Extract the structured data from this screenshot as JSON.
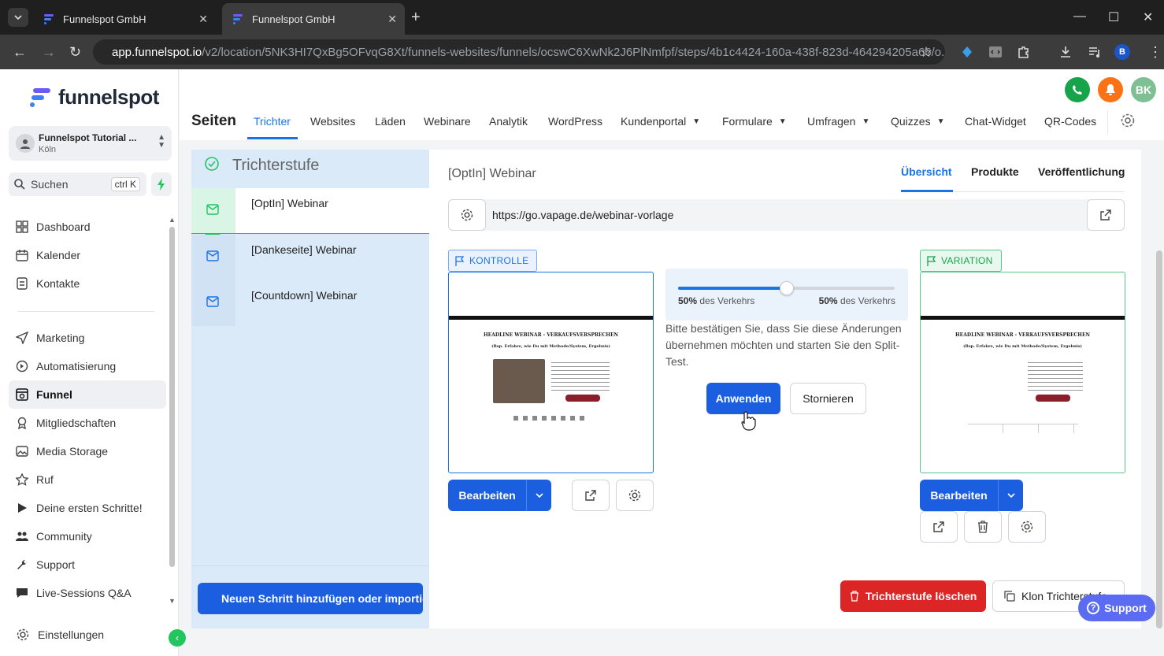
{
  "browser": {
    "tabs": [
      {
        "title": "Funnelspot GmbH",
        "active": false
      },
      {
        "title": "Funnelspot GmbH",
        "active": true
      }
    ],
    "address_host": "app.funnelspot.io",
    "address_path": "/v2/location/5NK3HI7QxBg5OFvqG8Xt/funnels-websites/funnels/ocswC6XwNk2J6PlNmfpf/steps/4b1c4424-160a-438f-823d-464294205a66/o...",
    "profile_initial": "B"
  },
  "sidebar": {
    "brand": "funnelspot",
    "location_name": "Funnelspot Tutorial ...",
    "location_city": "Köln",
    "search_label": "Suchen",
    "search_shortcut": "ctrl K",
    "items": [
      {
        "label": "Dashboard",
        "icon": "grid-icon"
      },
      {
        "label": "Kalender",
        "icon": "calendar-icon"
      },
      {
        "label": "Kontakte",
        "icon": "contacts-icon"
      },
      {
        "label": "Marketing",
        "icon": "send-icon"
      },
      {
        "label": "Automatisierung",
        "icon": "automation-icon"
      },
      {
        "label": "Funnel",
        "icon": "funnel-icon",
        "active": true
      },
      {
        "label": "Mitgliedschaften",
        "icon": "badge-icon"
      },
      {
        "label": "Media Storage",
        "icon": "image-icon"
      },
      {
        "label": "Ruf",
        "icon": "star-icon"
      },
      {
        "label": "Deine ersten Schritte!",
        "icon": "play-icon"
      },
      {
        "label": "Community",
        "icon": "users-icon"
      },
      {
        "label": "Support",
        "icon": "wrench-icon"
      },
      {
        "label": "Live-Sessions Q&A",
        "icon": "chat-icon"
      }
    ],
    "settings_label": "Einstellungen"
  },
  "topbar": {
    "avatar_initials": "BK",
    "page_title": "Seiten",
    "tabs": [
      "Trichter",
      "Websites",
      "Läden",
      "Webinare",
      "Analytik",
      "WordPress",
      "Kundenportal",
      "Formulare",
      "Umfragen",
      "Quizzes",
      "Chat-Widget",
      "QR-Codes"
    ]
  },
  "funnel": {
    "section_title": "Trichterstufe",
    "steps": [
      "[OptIn] Webinar",
      "[Dankeseite] Webinar",
      "[Countdown] Webinar"
    ],
    "add_step_label": "Neuen Schritt hinzufügen oder importieren"
  },
  "step_detail": {
    "title": "[OptIn] Webinar",
    "tabs": [
      "Übersicht",
      "Produkte",
      "Veröffentlichung"
    ],
    "url": "https://go.vapage.de/webinar-vorlage",
    "control_badge": "KONTROLLE",
    "variation_badge": "VARIATION",
    "split_left_pct": "50%",
    "split_right_pct": "50%",
    "split_suffix": "des Verkehrs",
    "traffic_split_fraction": 0.5,
    "confirm_text": "Bitte bestätigen Sie, dass Sie diese Änderungen übernehmen möchten und starten Sie den Split-Test.",
    "apply_label": "Anwenden",
    "cancel_label": "Stornieren",
    "edit_label": "Bearbeiten",
    "delete_stage_label": "Trichterstufe löschen",
    "clone_stage_label": "Klon Trichterstufe",
    "preview_headline": "HEADLINE WEBINAR - VERKAUFSVERSPRECHEN",
    "preview_subline": "(Bsp. Erfahre, wie Du mit Methode/System, Ergebnis)"
  },
  "support_label": "Support",
  "colors": {
    "primary": "#1b5fe0",
    "danger": "#dc2626",
    "success": "#22c55e",
    "accent_link": "#1b74e4"
  }
}
